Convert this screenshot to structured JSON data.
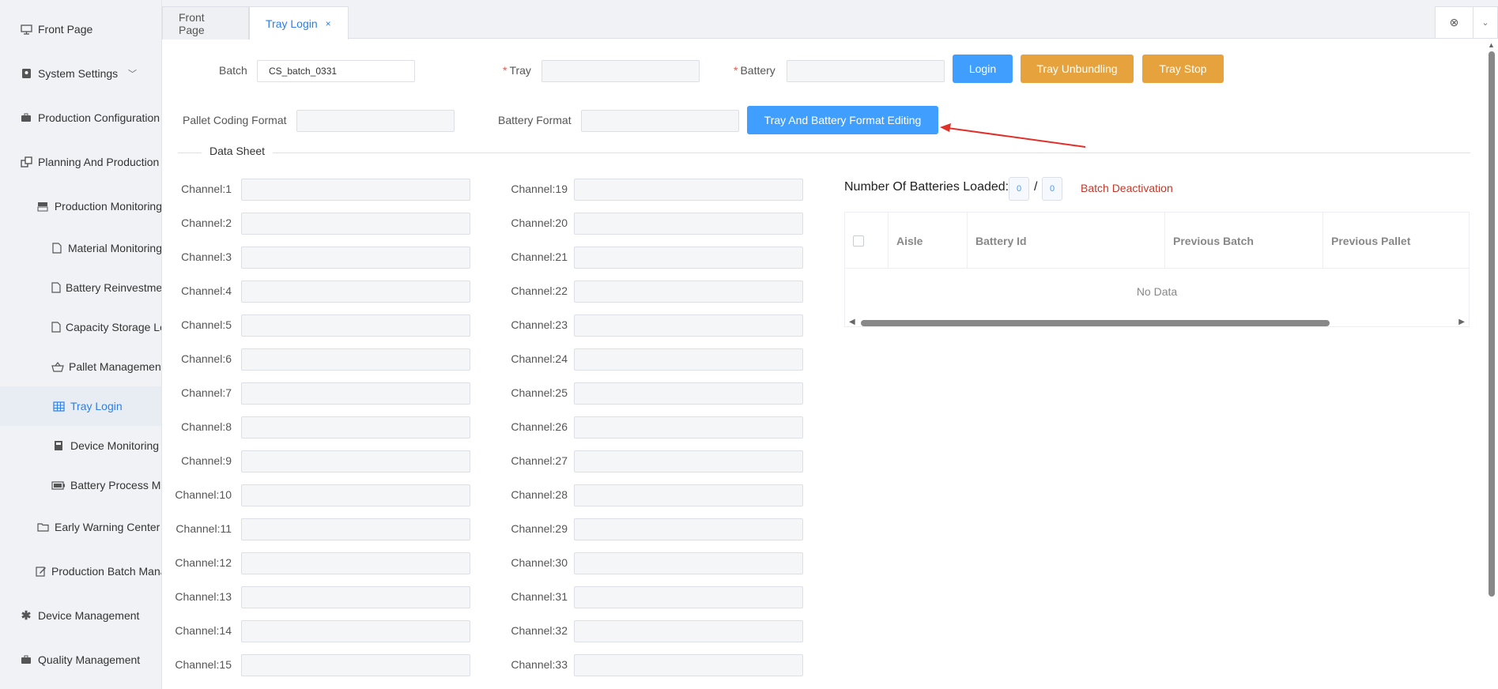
{
  "sidebar": {
    "items": [
      {
        "label": "Front Page",
        "icon": "monitor-icon"
      },
      {
        "label": "System Settings",
        "icon": "user-lock-icon"
      },
      {
        "label": "Production Configuration",
        "icon": "briefcase-icon"
      },
      {
        "label": "Planning And Production",
        "icon": "windows-icon"
      },
      {
        "label": "Production Monitoring",
        "icon": "server-icon"
      },
      {
        "label": "Material Monitoring",
        "icon": "document-icon"
      },
      {
        "label": "Battery Reinvestment",
        "icon": "document-icon"
      },
      {
        "label": "Capacity Storage Log",
        "icon": "document-icon"
      },
      {
        "label": "Pallet Management",
        "icon": "basket-icon"
      },
      {
        "label": "Tray Login",
        "icon": "table-icon"
      },
      {
        "label": "Device Monitoring",
        "icon": "device-icon"
      },
      {
        "label": "Battery Process Management",
        "icon": "battery-icon"
      },
      {
        "label": "Early Warning Center",
        "icon": "folder-icon"
      },
      {
        "label": "Production Batch Management",
        "icon": "edit-icon"
      },
      {
        "label": "Device Management",
        "icon": "asterisk-icon"
      },
      {
        "label": "Quality Management",
        "icon": "briefcase-icon"
      }
    ]
  },
  "tabs": [
    {
      "label": "Front Page"
    },
    {
      "label": "Tray Login",
      "close": "×"
    }
  ],
  "tab_tools": {
    "close_all": "⊗",
    "more": "⌄"
  },
  "form": {
    "batch_label": "Batch",
    "batch_value": "CS_batch_0331",
    "tray_label": "Tray",
    "tray_value": "",
    "battery_label": "Battery",
    "battery_value": "",
    "required_mark": "*",
    "login_button": "Login",
    "unbundling_button": "Tray Unbundling",
    "stop_button": "Tray Stop",
    "pallet_format_label": "Pallet Coding Format",
    "battery_format_label": "Battery Format",
    "format_edit_button": "Tray And Battery Format Editing"
  },
  "data_sheet_label": "Data Sheet",
  "channels_left": [
    "Channel:1",
    "Channel:2",
    "Channel:3",
    "Channel:4",
    "Channel:5",
    "Channel:6",
    "Channel:7",
    "Channel:8",
    "Channel:9",
    "Channel:10",
    "Channel:11",
    "Channel:12",
    "Channel:13",
    "Channel:14",
    "Channel:15"
  ],
  "channels_right": [
    "Channel:19",
    "Channel:20",
    "Channel:21",
    "Channel:22",
    "Channel:23",
    "Channel:24",
    "Channel:25",
    "Channel:26",
    "Channel:27",
    "Channel:28",
    "Channel:29",
    "Channel:30",
    "Channel:31",
    "Channel:32",
    "Channel:33"
  ],
  "loaded": {
    "label": "Number Of Batteries Loaded:",
    "current": "0",
    "separator": "/",
    "total": "0",
    "deactivation": "Batch Deactivation"
  },
  "table": {
    "columns": [
      "Aisle",
      "Battery Id",
      "Previous Batch",
      "Previous Pallet"
    ],
    "empty_text": "No Data"
  },
  "colors": {
    "accent": "#409eff",
    "warning": "#e6a23c",
    "danger": "#c0392b",
    "annotation_arrow": "#e0302a"
  }
}
